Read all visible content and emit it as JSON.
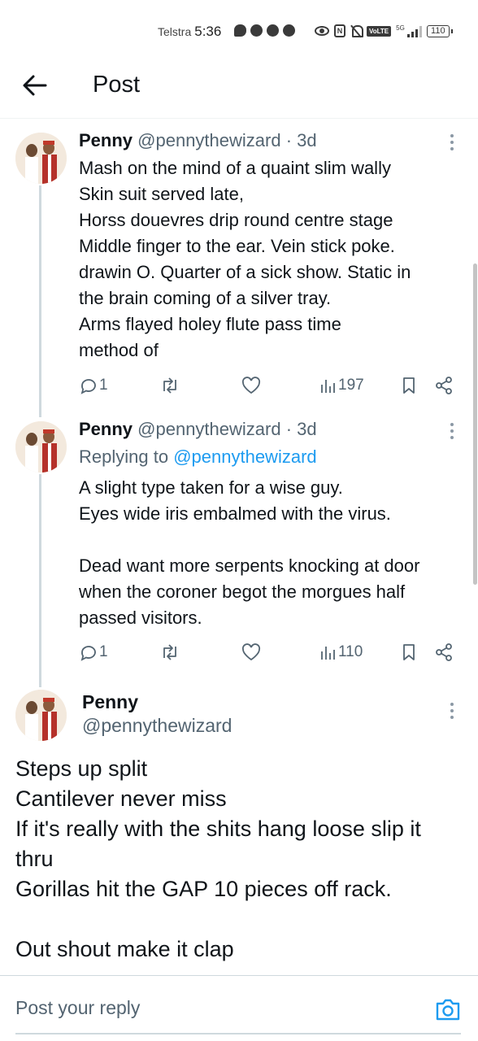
{
  "status_bar": {
    "carrier": "Telstra",
    "time": "5:36",
    "network": "5G",
    "volte": "VoLTE",
    "nfc": "N",
    "battery": "110"
  },
  "header": {
    "title": "Post"
  },
  "tweets": [
    {
      "name": "Penny",
      "handle": "@pennythewizard",
      "time": "· 3d",
      "lines": [
        "Mash on the mind of a quaint slim wally",
        "Skin suit served late,",
        "Horss douevres drip round centre stage",
        "Middle finger to the ear. Vein stick poke.",
        "drawin O. Quarter of a sick show. Static in",
        "the brain coming of a silver tray.",
        "Arms flayed holey flute pass time",
        "method of"
      ],
      "replies": "1",
      "views": "197"
    },
    {
      "name": "Penny",
      "handle": "@pennythewizard",
      "time": "· 3d",
      "replying_label": "Replying to",
      "replying_handle": "@pennythewizard",
      "lines": [
        "A slight type taken for a wise guy.",
        "Eyes wide iris embalmed with the virus.",
        "",
        "Dead want more serpents knocking at door",
        "when the coroner begot the morgues half",
        "passed visitors."
      ],
      "replies": "1",
      "views": "110"
    }
  ],
  "main_tweet": {
    "name": "Penny",
    "handle": "@pennythewizard",
    "lines": [
      "Steps up split",
      "Cantilever never miss",
      "If it's really with the shits hang loose slip it",
      "thru",
      "Gorillas hit the GAP 10 pieces off rack.",
      "",
      "Out shout make it clap"
    ]
  },
  "reply_bar": {
    "placeholder": "Post your reply"
  },
  "colors": {
    "text": "#0f1419",
    "secondary": "#536471",
    "link": "#1d9bf0",
    "divider": "#cfd9de"
  }
}
